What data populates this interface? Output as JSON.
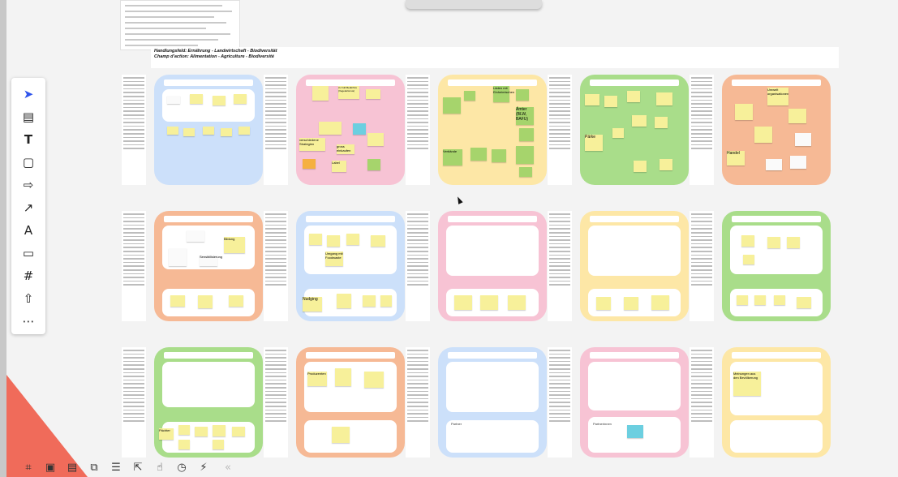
{
  "header": {
    "line1": "Handlungsfeld: Ernährung - Landwirtschaft - Biodiversität",
    "line2": "Champ d'action: Alimentation - Agriculture - Biodiversité"
  },
  "colors": {
    "blue": "#cce0fa",
    "pink": "#f7c3d4",
    "yellow": "#fde7a6",
    "green": "#a9dd8a",
    "orange": "#f6b995",
    "triangle": "#f06b5a",
    "accent": "#2f54eb"
  },
  "cards": [
    {
      "color": "#cce0fa",
      "row": 0
    },
    {
      "color": "#f7c3d4",
      "row": 0
    },
    {
      "color": "#fde7a6",
      "row": 0
    },
    {
      "color": "#a9dd8a",
      "row": 0
    },
    {
      "color": "#f6b995",
      "row": 0
    },
    {
      "color": "#f6b995",
      "row": 1
    },
    {
      "color": "#cce0fa",
      "row": 1
    },
    {
      "color": "#f7c3d4",
      "row": 1
    },
    {
      "color": "#fde7a6",
      "row": 1
    },
    {
      "color": "#a9dd8a",
      "row": 1
    },
    {
      "color": "#a9dd8a",
      "row": 2
    },
    {
      "color": "#f6b995",
      "row": 2
    },
    {
      "color": "#cce0fa",
      "row": 2
    },
    {
      "color": "#f7c3d4",
      "row": 2
    },
    {
      "color": "#fde7a6",
      "row": 2
    }
  ],
  "card_words": {
    "c1_a": "Lasten zum Einkaufen",
    "c2_a": "zu Fuß Bedürfnis (Vegetarismus)",
    "c2_b": "verschiedene Strategien",
    "c2_c": "Label",
    "c2_d": "gross einkaufen",
    "c3_a": "Läden mit Einheimischen",
    "c3_b": "Ämter (BLW, BAFU)",
    "c3_c": "Verbände",
    "c4_a": "Pärke",
    "c5_a": "Umwelt organisationen",
    "c5_b": "Handel",
    "c6_a": "Bildung",
    "c6_b": "Sensibilisierung",
    "c7_a": "Nudging",
    "c7_b": "Umgang mit Foodwaste",
    "c11_a": "Pächter",
    "c12_a": "Produzenten",
    "c13_a": "Partner",
    "c14_a": "Partnerinnen",
    "c15_a": "Meinungen aus den Bevölkerung"
  },
  "toolbar": {
    "tools": [
      "select",
      "frame",
      "text",
      "sticky-note",
      "shape",
      "arrow",
      "pen",
      "comment",
      "grid",
      "upload",
      "more"
    ]
  },
  "bottom_toolbar": {
    "items": [
      "frame-tool",
      "comment-add",
      "comment",
      "copy",
      "list",
      "export",
      "like",
      "timer",
      "voting",
      "collapse"
    ]
  }
}
